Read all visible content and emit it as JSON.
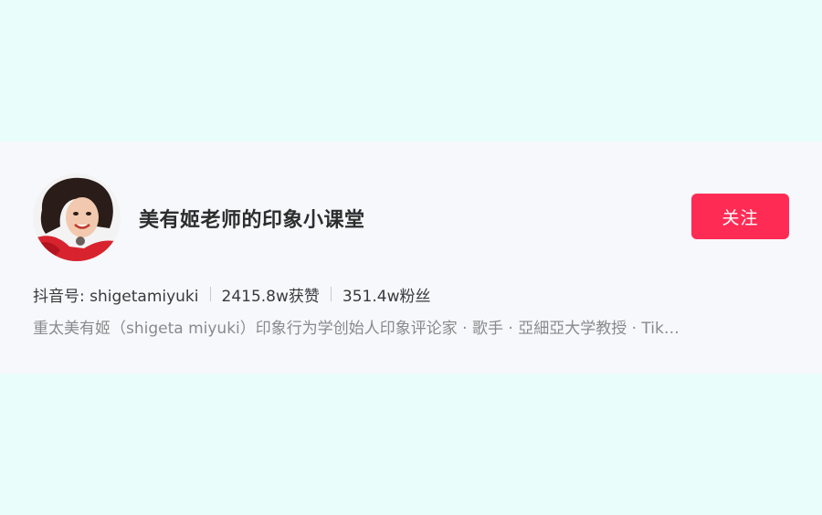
{
  "profile": {
    "nickname": "美有姬老师的印象小课堂",
    "follow_label": "关注",
    "douyin_id": "抖音号: shigetamiyuki",
    "likes": "2415.8w获赞",
    "followers": "351.4w粉丝",
    "bio": "重太美有姬（shigeta miyuki）印象行为学创始人印象评论家 · 歌手 · 亞細亞大学教授 · Tik…"
  },
  "colors": {
    "page_bg": "#e9fdfb",
    "card_bg": "#f7f8fc",
    "accent": "#fe2c55"
  }
}
